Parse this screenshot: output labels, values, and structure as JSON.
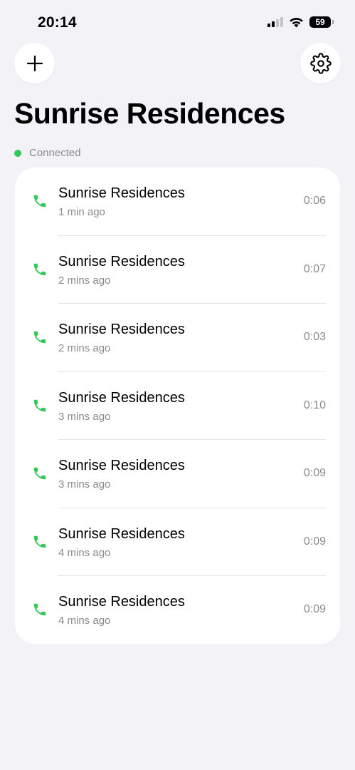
{
  "status_bar": {
    "time": "20:14",
    "battery": "59"
  },
  "header": {
    "title": "Sunrise Residences",
    "connection_status": "Connected"
  },
  "icons": {
    "add": "plus-icon",
    "settings": "gear-icon",
    "call": "phone-icon"
  },
  "colors": {
    "connected": "#34c759",
    "call_icon": "#34c759",
    "background": "#f2f2f7"
  },
  "calls": [
    {
      "name": "Sunrise Residences",
      "time_ago": "1 min ago",
      "duration": "0:06"
    },
    {
      "name": "Sunrise Residences",
      "time_ago": "2 mins ago",
      "duration": "0:07"
    },
    {
      "name": "Sunrise Residences",
      "time_ago": "2 mins ago",
      "duration": "0:03"
    },
    {
      "name": "Sunrise Residences",
      "time_ago": "3 mins ago",
      "duration": "0:10"
    },
    {
      "name": "Sunrise Residences",
      "time_ago": "3 mins ago",
      "duration": "0:09"
    },
    {
      "name": "Sunrise Residences",
      "time_ago": "4 mins ago",
      "duration": "0:09"
    },
    {
      "name": "Sunrise Residences",
      "time_ago": "4 mins ago",
      "duration": "0:09"
    }
  ]
}
